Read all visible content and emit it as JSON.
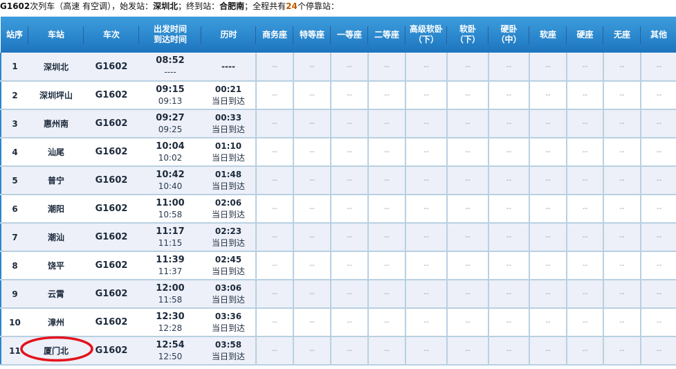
{
  "summary": {
    "train_no": "G1602",
    "train_suffix": "次列车（高速 有空调），始发站：",
    "origin": "深圳北",
    "mid_label": "；终到站：",
    "destination": "合肥南",
    "stops_prefix": "；全程共有",
    "stop_count": "24",
    "stops_suffix": "个停靠站："
  },
  "headers": {
    "seq": "站序",
    "station": "车站",
    "train": "车次",
    "time_line1": "出发时间",
    "time_line2": "到达时间",
    "duration": "历时",
    "business": "商务座",
    "premium": "特等座",
    "first": "一等座",
    "second": "二等座",
    "deluxe_sleeper_l1": "高级软卧",
    "deluxe_sleeper_l2": "（下）",
    "soft_sleeper_l1": "软卧",
    "soft_sleeper_l2": "（下）",
    "hard_sleeper_l1": "硬卧",
    "hard_sleeper_l2": "（中）",
    "soft_seat": "软座",
    "hard_seat": "硬座",
    "no_seat": "无座",
    "other": "其他"
  },
  "seat_placeholder": "--",
  "rows": [
    {
      "seq": "1",
      "station": "深圳北",
      "train": "G1602",
      "depart": "08:52",
      "arrive": "----",
      "duration": "----",
      "day": ""
    },
    {
      "seq": "2",
      "station": "深圳坪山",
      "train": "G1602",
      "depart": "09:15",
      "arrive": "09:13",
      "duration": "00:21",
      "day": "当日到达"
    },
    {
      "seq": "3",
      "station": "惠州南",
      "train": "G1602",
      "depart": "09:27",
      "arrive": "09:25",
      "duration": "00:33",
      "day": "当日到达"
    },
    {
      "seq": "4",
      "station": "汕尾",
      "train": "G1602",
      "depart": "10:04",
      "arrive": "10:02",
      "duration": "01:10",
      "day": "当日到达"
    },
    {
      "seq": "5",
      "station": "普宁",
      "train": "G1602",
      "depart": "10:42",
      "arrive": "10:40",
      "duration": "01:48",
      "day": "当日到达"
    },
    {
      "seq": "6",
      "station": "潮阳",
      "train": "G1602",
      "depart": "11:00",
      "arrive": "10:58",
      "duration": "02:06",
      "day": "当日到达"
    },
    {
      "seq": "7",
      "station": "潮汕",
      "train": "G1602",
      "depart": "11:17",
      "arrive": "11:15",
      "duration": "02:23",
      "day": "当日到达"
    },
    {
      "seq": "8",
      "station": "饶平",
      "train": "G1602",
      "depart": "11:39",
      "arrive": "11:37",
      "duration": "02:45",
      "day": "当日到达"
    },
    {
      "seq": "9",
      "station": "云霄",
      "train": "G1602",
      "depart": "12:00",
      "arrive": "11:58",
      "duration": "03:06",
      "day": "当日到达"
    },
    {
      "seq": "10",
      "station": "漳州",
      "train": "G1602",
      "depart": "12:30",
      "arrive": "12:28",
      "duration": "03:36",
      "day": "当日到达"
    },
    {
      "seq": "11",
      "station": "厦门北",
      "train": "G1602",
      "depart": "12:54",
      "arrive": "12:50",
      "duration": "03:58",
      "day": "当日到达"
    }
  ],
  "annotation": {
    "highlighted_station": "厦门北",
    "color": "#e3121c"
  }
}
